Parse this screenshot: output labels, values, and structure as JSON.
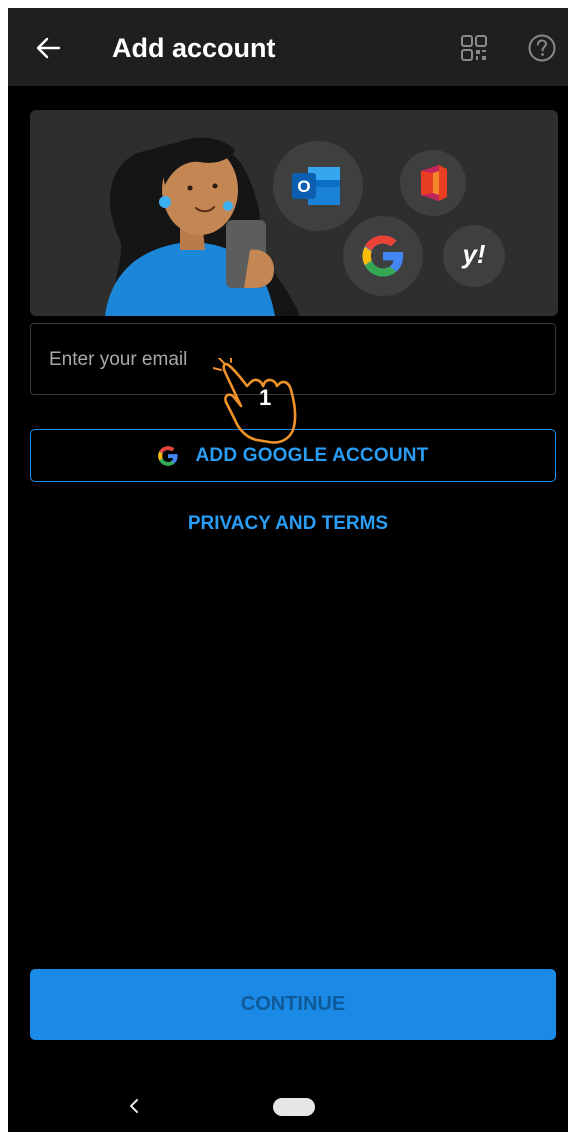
{
  "header": {
    "title": "Add account",
    "back_icon": "arrow-left-icon",
    "qr_icon": "qr-code-icon",
    "help_icon": "help-circle-icon"
  },
  "hero": {
    "icons": [
      "outlook-icon",
      "office-icon",
      "google-icon",
      "yahoo-icon"
    ],
    "yahoo_text": "y!",
    "outlook_letter": "O"
  },
  "email": {
    "placeholder": "Enter your email",
    "value": ""
  },
  "google_button": {
    "label": "ADD GOOGLE ACCOUNT"
  },
  "privacy": {
    "label": "PRIVACY AND TERMS"
  },
  "continue_button": {
    "label": "CONTINUE"
  },
  "annotation": {
    "step": "1"
  },
  "colors": {
    "accent": "#2a9df4",
    "background": "#000000",
    "app_bar": "#1f1f1f",
    "hero_bg": "#2e2e2e",
    "continue_bg": "#1a8ae6",
    "continue_text": "#0f5a98"
  }
}
